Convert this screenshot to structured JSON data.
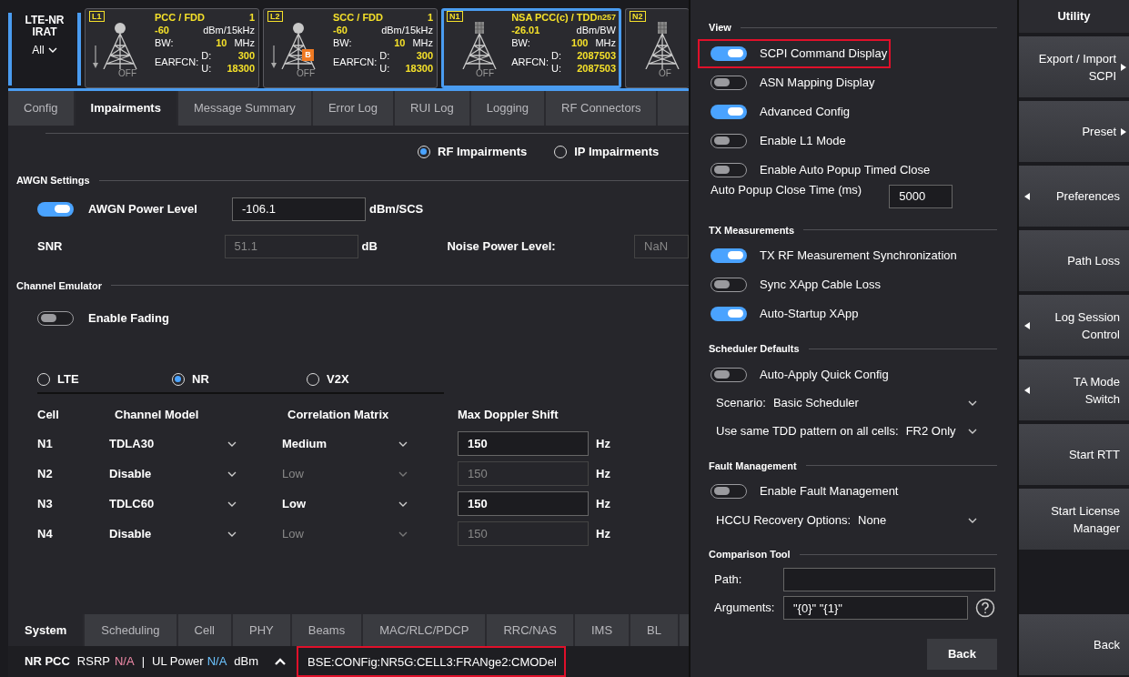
{
  "header": {
    "mode": {
      "title": "LTE-NR IRAT",
      "selector": "All"
    },
    "cells": [
      {
        "kind": "lte",
        "tag": "L1",
        "title": "PCC / FDD",
        "band": "1",
        "power": "-60",
        "power_unit": "dBm/15kHz",
        "bw_label": "BW:",
        "bw": "10",
        "bw_unit": "MHz",
        "freq_label": "EARFCN:",
        "dl_label": "D:",
        "dl": "300",
        "ul_label": "U:",
        "ul": "18300",
        "state": "OFF",
        "selected": false
      },
      {
        "kind": "lte",
        "tag": "L2",
        "badge": "B",
        "title": "SCC / FDD",
        "band": "1",
        "power": "-60",
        "power_unit": "dBm/15kHz",
        "bw_label": "BW:",
        "bw": "10",
        "bw_unit": "MHz",
        "freq_label": "EARFCN:",
        "dl_label": "D:",
        "dl": "300",
        "ul_label": "U:",
        "ul": "18300",
        "state": "OFF",
        "selected": false
      },
      {
        "kind": "nr",
        "tag": "N1",
        "title": "NSA PCC(c) / TDD",
        "band": "n257",
        "power": "-26.01",
        "power_unit": "dBm/BW",
        "bw_label": "BW:",
        "bw": "100",
        "bw_unit": "MHz",
        "freq_label": "ARFCN:",
        "dl_label": "D:",
        "dl": "2087503",
        "ul_label": "U:",
        "ul": "2087503",
        "state": "OFF",
        "selected": true
      },
      {
        "kind": "nr",
        "tag": "N2",
        "state": "OF",
        "selected": false
      }
    ]
  },
  "tabs": [
    {
      "label": "Config",
      "selected": false
    },
    {
      "label": "Impairments",
      "selected": true
    },
    {
      "label": "Message Summary",
      "selected": false
    },
    {
      "label": "Error Log",
      "selected": false
    },
    {
      "label": "RUI Log",
      "selected": false
    },
    {
      "label": "Logging",
      "selected": false
    },
    {
      "label": "RF Connectors",
      "selected": false
    }
  ],
  "impairment_type": [
    {
      "label": "RF Impairments",
      "selected": true
    },
    {
      "label": "IP Impairments",
      "selected": false
    }
  ],
  "awgn": {
    "title": "AWGN Settings",
    "power": {
      "label": "AWGN Power Level",
      "on": true,
      "value": "-106.1",
      "unit": "dBm/SCS"
    },
    "snr": {
      "label": "SNR",
      "value": "51.1",
      "unit": "dB"
    },
    "noise": {
      "label": "Noise Power Level:",
      "value": "NaN"
    }
  },
  "channel_emulator": {
    "title": "Channel Emulator",
    "fading": {
      "label": "Enable Fading",
      "on": false
    },
    "technologies": [
      {
        "label": "LTE",
        "selected": false
      },
      {
        "label": "NR",
        "selected": true
      },
      {
        "label": "V2X",
        "selected": false
      }
    ],
    "columns": [
      "Cell",
      "Channel Model",
      "Correlation Matrix",
      "Max Doppler Shift"
    ],
    "rows": [
      {
        "cell": "N1",
        "model": "TDLA30",
        "correlation": "Medium",
        "doppler": "150",
        "unit": "Hz",
        "disabled": false
      },
      {
        "cell": "N2",
        "model": "Disable",
        "correlation": "Low",
        "doppler": "150",
        "unit": "Hz",
        "disabled": true
      },
      {
        "cell": "N3",
        "model": "TDLC60",
        "correlation": "Low",
        "doppler": "150",
        "unit": "Hz",
        "disabled": false
      },
      {
        "cell": "N4",
        "model": "Disable",
        "correlation": "Low",
        "doppler": "150",
        "unit": "Hz",
        "disabled": true
      }
    ]
  },
  "bottom_tabs": [
    {
      "label": "System",
      "selected": true
    },
    {
      "label": "Scheduling",
      "selected": false
    },
    {
      "label": "Cell",
      "selected": false
    },
    {
      "label": "PHY",
      "selected": false
    },
    {
      "label": "Beams",
      "selected": false
    },
    {
      "label": "MAC/RLC/PDCP",
      "selected": false
    },
    {
      "label": "RRC/NAS",
      "selected": false
    },
    {
      "label": "IMS",
      "selected": false
    },
    {
      "label": "BL",
      "selected": false
    }
  ],
  "status_bar": {
    "cell": "NR PCC",
    "rsrp_label": "RSRP",
    "rsrp": "N/A",
    "sep": "|",
    "ul_label": "UL Power",
    "ul": "N/A",
    "ul_unit": "dBm",
    "scpi": {
      "text": "BSE:CONFig:NR5G:CELL3:FRANge2:CMODel",
      "highlighted": true
    }
  },
  "settings": {
    "sections": [
      {
        "title": "View",
        "items": [
          {
            "kind": "toggle",
            "label": "SCPI Command Display",
            "on": true,
            "highlighted": true
          },
          {
            "kind": "toggle",
            "label": "ASN Mapping Display",
            "on": false
          },
          {
            "kind": "toggle",
            "label": "Advanced Config",
            "on": true
          },
          {
            "kind": "toggle",
            "label": "Enable L1 Mode",
            "on": false
          },
          {
            "kind": "toggle",
            "label": "Enable Auto Popup Timed Close",
            "on": false
          },
          {
            "kind": "number",
            "label": "Auto Popup Close Time (ms)",
            "value": "5000"
          }
        ]
      },
      {
        "title": "TX Measurements",
        "items": [
          {
            "kind": "toggle",
            "label": "TX RF Measurement Synchronization",
            "on": true
          },
          {
            "kind": "toggle",
            "label": "Sync XApp Cable Loss",
            "on": false
          },
          {
            "kind": "toggle",
            "label": "Auto-Startup XApp",
            "on": true
          }
        ]
      },
      {
        "title": "Scheduler Defaults",
        "items": [
          {
            "kind": "toggle",
            "label": "Auto-Apply Quick Config",
            "on": false
          },
          {
            "kind": "dropdown",
            "label": "Scenario:",
            "value": "Basic Scheduler"
          },
          {
            "kind": "dropdown",
            "label": "Use same TDD pattern on all cells:",
            "value": "FR2 Only"
          }
        ]
      },
      {
        "title": "Fault Management",
        "items": [
          {
            "kind": "toggle",
            "label": "Enable Fault Management",
            "on": false
          },
          {
            "kind": "dropdown",
            "label": "HCCU Recovery Options:",
            "value": "None"
          }
        ]
      },
      {
        "title": "Comparison Tool",
        "items": [
          {
            "kind": "text",
            "label": "Path:"
          },
          {
            "kind": "text",
            "label": "Arguments:",
            "value": "\"{0}\" \"{1}\"",
            "help": true
          }
        ]
      }
    ],
    "back": "Back"
  },
  "utility": {
    "title": "Utility",
    "buttons": [
      {
        "kind": "right",
        "label": "Export / Import SCPI"
      },
      {
        "kind": "right",
        "label": "Preset"
      },
      {
        "kind": "left",
        "label": "Preferences"
      },
      {
        "kind": "plain",
        "label": "Path Loss"
      },
      {
        "kind": "left",
        "label": "Log Session Control"
      },
      {
        "kind": "left",
        "label": "TA Mode Switch"
      },
      {
        "kind": "plain",
        "label": "Start RTT"
      },
      {
        "kind": "plain",
        "label": "Start License Manager"
      }
    ],
    "back": "Back"
  }
}
